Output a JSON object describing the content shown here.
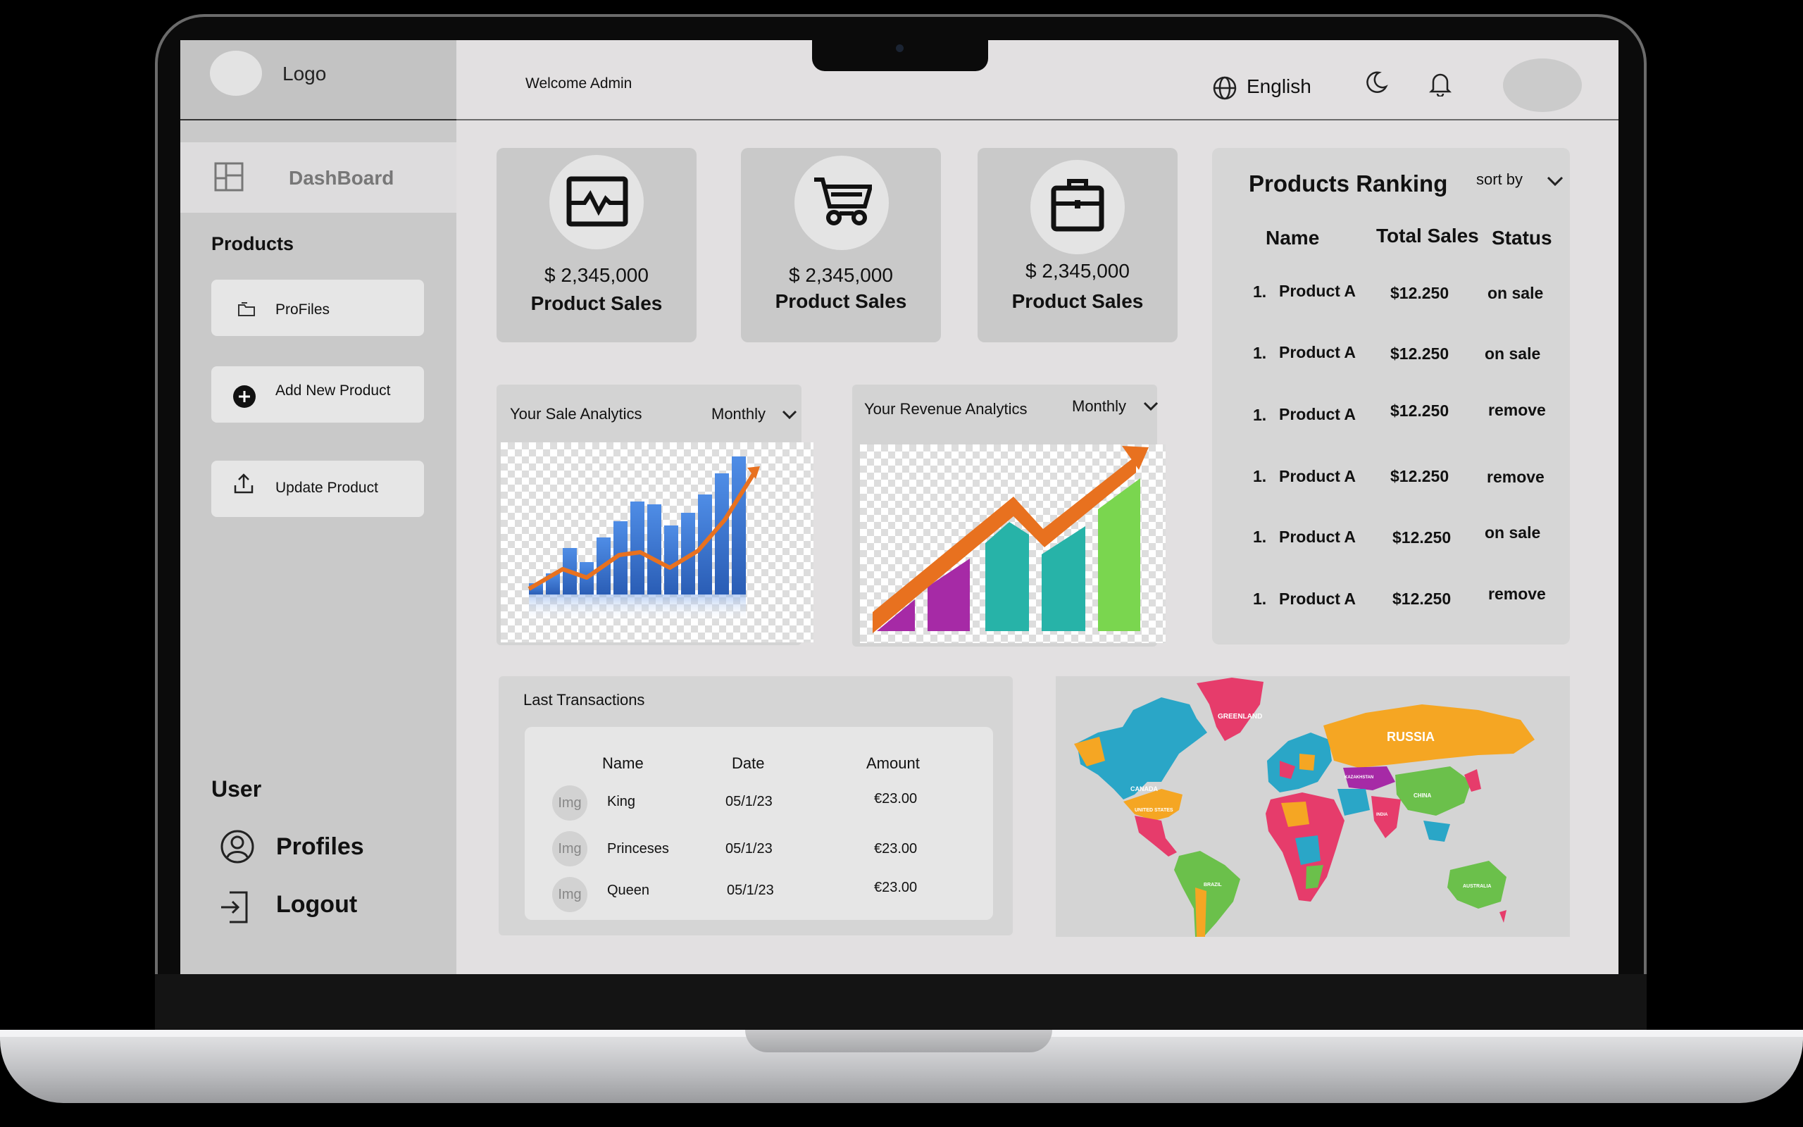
{
  "sidebar": {
    "logo_text": "Logo",
    "dashboard_label": "DashBoard",
    "products_heading": "Products",
    "product_items": [
      "ProFiles",
      "Add New Product",
      "Update Product"
    ],
    "user_heading": "User",
    "user_items": [
      "Profiles",
      "Logout"
    ]
  },
  "header": {
    "welcome": "Welcome Admin",
    "language": "English"
  },
  "stats": [
    {
      "value": "$ 2,345,000",
      "label": "Product Sales",
      "icon": "analytics-icon"
    },
    {
      "value": "$ 2,345,000",
      "label": "Product Sales",
      "icon": "cart-icon"
    },
    {
      "value": "$ 2,345,000",
      "label": "Product Sales",
      "icon": "briefcase-icon"
    }
  ],
  "ranking": {
    "title": "Products Ranking",
    "sort_label": "sort by",
    "columns": [
      "Name",
      "Total Sales",
      "Status"
    ],
    "rows": [
      {
        "rank": "1.",
        "name": "Product A",
        "sales": "$12.250",
        "status": "on sale"
      },
      {
        "rank": "1.",
        "name": "Product A",
        "sales": "$12.250",
        "status": "on sale"
      },
      {
        "rank": "1.",
        "name": "Product A",
        "sales": "$12.250",
        "status": "remove"
      },
      {
        "rank": "1.",
        "name": "Product A",
        "sales": "$12.250",
        "status": "remove"
      },
      {
        "rank": "1.",
        "name": "Product A",
        "sales": "$12.250",
        "status": "on sale"
      },
      {
        "rank": "1.",
        "name": "Product A",
        "sales": "$12.250",
        "status": "remove"
      }
    ]
  },
  "analytics": [
    {
      "title": "Your Sale Analytics",
      "period": "Monthly"
    },
    {
      "title": "Your Revenue Analytics",
      "period": "Monthly"
    }
  ],
  "transactions": {
    "title": "Last Transactions",
    "columns": [
      "Name",
      "Date",
      "Amount"
    ],
    "rows": [
      {
        "img": "Img",
        "name": "King",
        "date": "05/1/23",
        "amount": "€23.00"
      },
      {
        "img": "Img",
        "name": "Princeses",
        "date": "05/1/23",
        "amount": "€23.00"
      },
      {
        "img": "Img",
        "name": "Queen",
        "date": "05/1/23",
        "amount": "€23.00"
      }
    ]
  },
  "map": {
    "labels": [
      "GREENLAND",
      "RUSSIA",
      "CANADA",
      "UNITED STATES",
      "CHINA",
      "BRAZIL",
      "AUSTRALIA",
      "KAZAKHSTAN",
      "INDIA"
    ]
  },
  "colors": {
    "screen_bg": "#e2e0e1",
    "sidebar_bg": "#c9c9c9",
    "card_bg": "#c9c9c9",
    "bar_blue": "#3b78d0",
    "trend_orange": "#e8711f",
    "bar_purple": "#a62aa6",
    "bar_teal": "#27b3a8",
    "bar_green": "#7ad64f"
  }
}
